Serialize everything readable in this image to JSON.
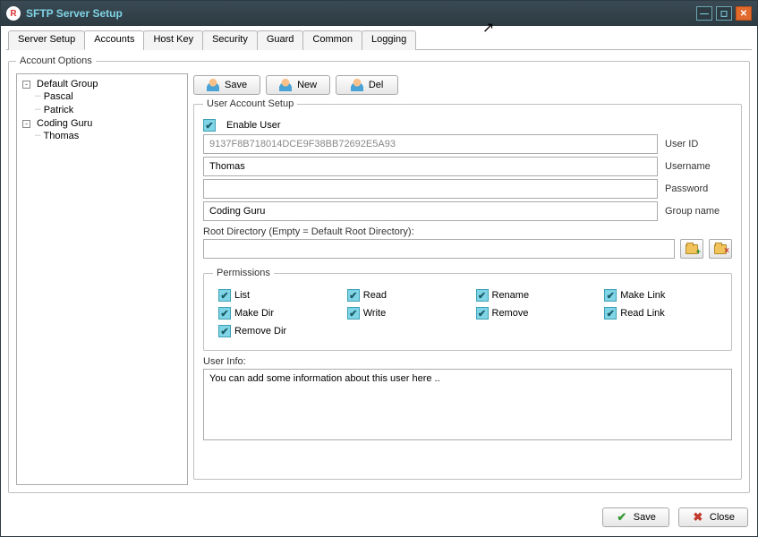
{
  "window": {
    "title": "SFTP Server Setup",
    "logo_letter": "R"
  },
  "tabs": [
    "Server Setup",
    "Accounts",
    "Host Key",
    "Security",
    "Guard",
    "Common",
    "Logging"
  ],
  "active_tab_index": 1,
  "account_options_legend": "Account Options",
  "tree": [
    {
      "label": "Default Group",
      "expanded": true,
      "children": [
        "Pascal",
        "Patrick"
      ]
    },
    {
      "label": "Coding Guru",
      "expanded": true,
      "children": [
        "Thomas"
      ]
    }
  ],
  "toolbar": {
    "save": "Save",
    "new": "New",
    "del": "Del"
  },
  "user_setup": {
    "legend": "User Account Setup",
    "enable_label": "Enable User",
    "enable_checked": true,
    "user_id": "9137F8B718014DCE9F38BB72692E5A93",
    "user_id_label": "User ID",
    "username": "Thomas",
    "username_label": "Username",
    "password": "",
    "password_label": "Password",
    "group": "Coding Guru",
    "group_label": "Group name",
    "root_label": "Root Directory (Empty = Default Root Directory):",
    "root_value": ""
  },
  "permissions": {
    "legend": "Permissions",
    "items": [
      {
        "label": "List",
        "checked": true
      },
      {
        "label": "Read",
        "checked": true
      },
      {
        "label": "Rename",
        "checked": true
      },
      {
        "label": "Make Link",
        "checked": true
      },
      {
        "label": "Make Dir",
        "checked": true
      },
      {
        "label": "Write",
        "checked": true
      },
      {
        "label": "Remove",
        "checked": true
      },
      {
        "label": "Read Link",
        "checked": true
      },
      {
        "label": "Remove Dir",
        "checked": true
      }
    ]
  },
  "user_info": {
    "label": "User Info:",
    "text": "You can add some information about this user here .."
  },
  "footer": {
    "save": "Save",
    "close": "Close"
  }
}
